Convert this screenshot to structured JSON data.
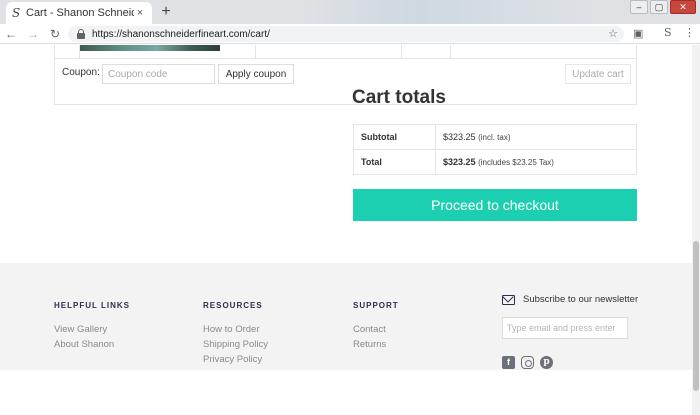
{
  "browser": {
    "tab_title": "Cart - Shanon Schneider F",
    "favicon": "S",
    "close_glyph": "×",
    "new_tab_glyph": "+",
    "url": "https://shanonschneiderfineart.com/cart/",
    "ext_label": "S"
  },
  "cart": {
    "coupon_label": "Coupon:",
    "coupon_placeholder": "Coupon code",
    "apply_label": "Apply coupon",
    "update_label": "Update cart"
  },
  "totals": {
    "title": "Cart totals",
    "subtotal_label": "Subtotal",
    "subtotal_value": "$323.25",
    "subtotal_note": "(incl. tax)",
    "total_label": "Total",
    "total_value": "$323.25",
    "total_note": "(includes $23.25 Tax)",
    "checkout_label": "Proceed to checkout",
    "accent_color": "#1ccfb0"
  },
  "footer": {
    "helpful": {
      "heading": "HELPFUL LINKS",
      "links": [
        "View Gallery",
        "About Shanon"
      ]
    },
    "resources": {
      "heading": "RESOURCES",
      "links": [
        "How to Order",
        "Shipping Policy",
        "Privacy Policy"
      ]
    },
    "support": {
      "heading": "SUPPORT",
      "links": [
        "Contact",
        "Returns"
      ]
    },
    "newsletter": {
      "label": "Subscribe to our newsletter",
      "placeholder": "Type email and press enter"
    },
    "social_icons": [
      "facebook-icon",
      "instagram-icon",
      "pinterest-icon"
    ]
  }
}
